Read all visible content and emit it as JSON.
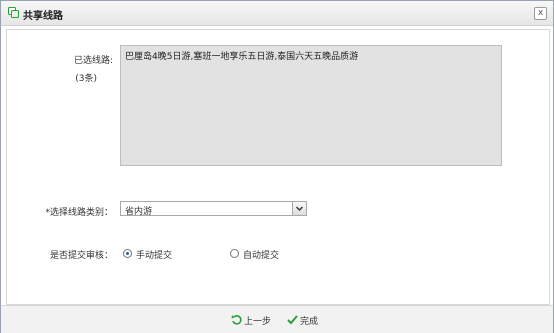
{
  "dialog": {
    "title": "共享线路",
    "close_glyph": "x"
  },
  "form": {
    "selected_label": "已选线路:",
    "selected_count": "(3条)",
    "selected_routes": "巴厘岛4晚5日游,塞班一地享乐五日游,泰国六天五晚品质游",
    "category_label": "*选择线路类别：",
    "category_value": "省内游",
    "audit_label": "是否提交审核：",
    "audit_options": [
      {
        "label": "手动提交",
        "selected": true
      },
      {
        "label": "自动提交",
        "selected": false
      }
    ]
  },
  "footer": {
    "prev_label": "上一步",
    "done_label": "完成"
  },
  "colors": {
    "accent_green": "#2e9e3a",
    "radio_blue": "#2b5fa5"
  },
  "icons": {
    "title": "share-routes-icon",
    "prev": "undo-arrow-icon",
    "done": "checkmark-icon"
  }
}
